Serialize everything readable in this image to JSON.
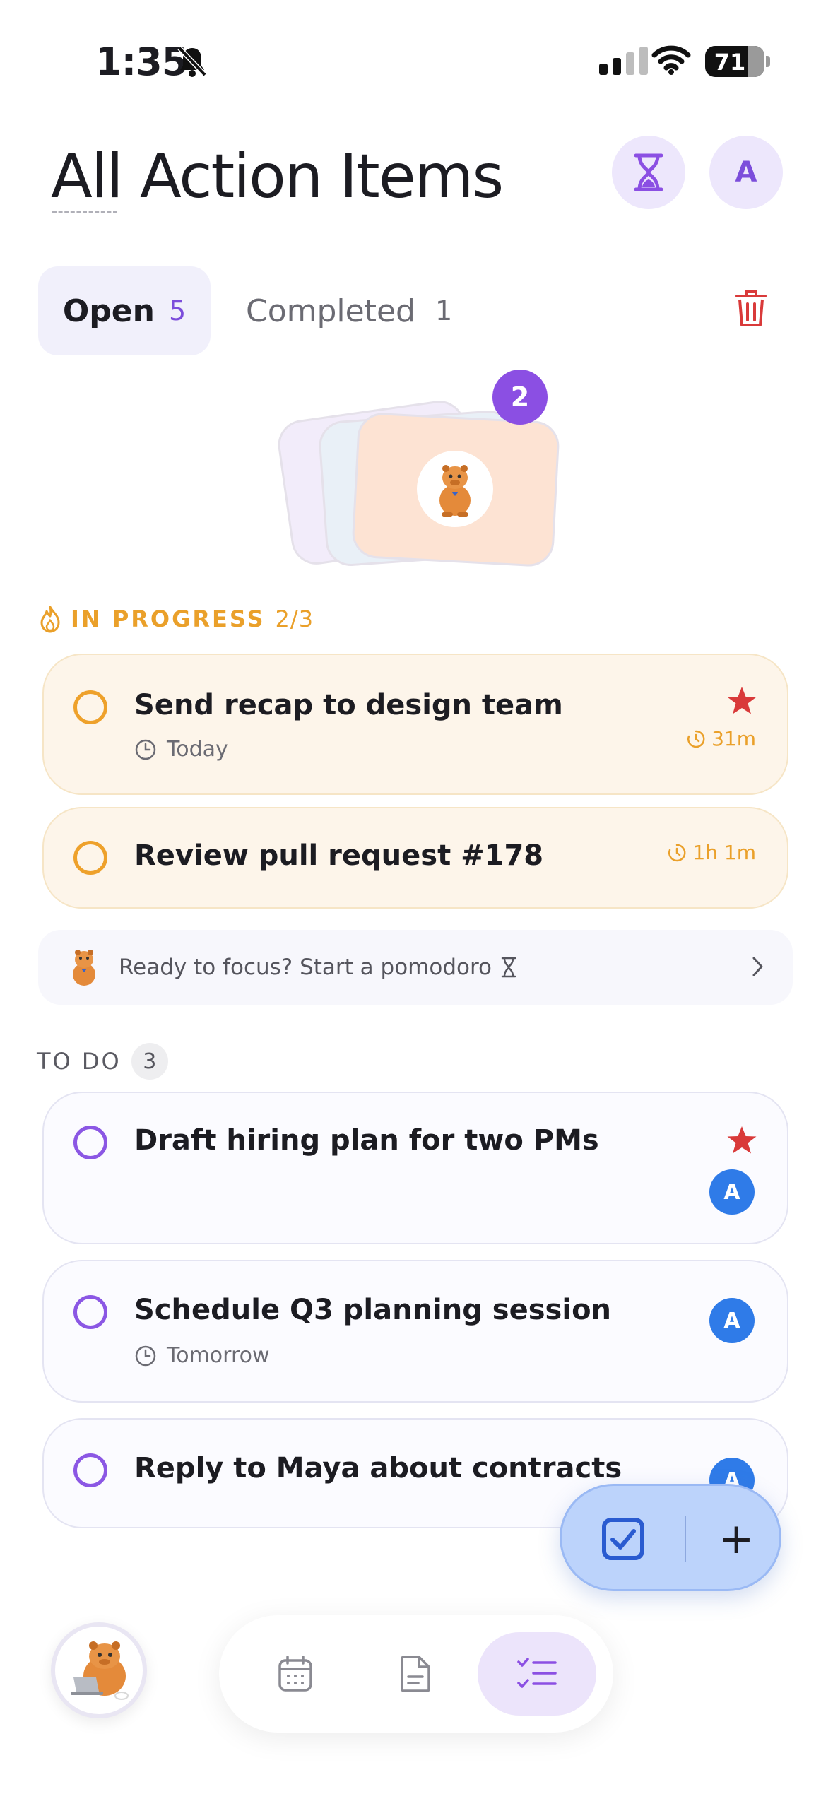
{
  "status_bar": {
    "time": "1:35",
    "battery": "71",
    "battery_level": 0.71
  },
  "header": {
    "title": "All Action Items",
    "avatar_initial": "A"
  },
  "tabs": [
    {
      "label": "Open",
      "count": "5"
    },
    {
      "label": "Completed",
      "count": "1"
    }
  ],
  "card_stack": {
    "badge": "2"
  },
  "in_progress": {
    "label": "IN PROGRESS",
    "count": "2/3",
    "tasks": [
      {
        "title": "Send recap to design team",
        "due": "Today",
        "timer": "31m",
        "starred": true
      },
      {
        "title": "Review pull request #178",
        "timer": "1h 1m"
      }
    ]
  },
  "focus_banner": {
    "text": "Ready to focus? Start a pomodoro"
  },
  "todo": {
    "label": "TO DO",
    "count": "3",
    "tasks": [
      {
        "title": "Draft hiring plan for two PMs",
        "assignee": "A",
        "starred": true
      },
      {
        "title": "Schedule Q3 planning session",
        "due": "Tomorrow",
        "assignee": "A"
      },
      {
        "title": "Reply to Maya about contracts",
        "assignee": "A"
      }
    ]
  },
  "colors": {
    "accent_purple": "#8b4fe3",
    "in_progress_orange": "#eaa02a",
    "star_red": "#d93a3a",
    "avatar_blue": "#2f7be8",
    "fab_blue": "#bcd3fb"
  },
  "icons": [
    "bell-slash-icon",
    "hourglass-icon",
    "trash-icon",
    "flame-icon",
    "clock-icon",
    "star-icon",
    "timer-icon",
    "chevron-right-icon",
    "checkbox-icon",
    "plus-icon",
    "calendar-icon",
    "document-icon",
    "checklist-icon",
    "capybara-mascot"
  ]
}
